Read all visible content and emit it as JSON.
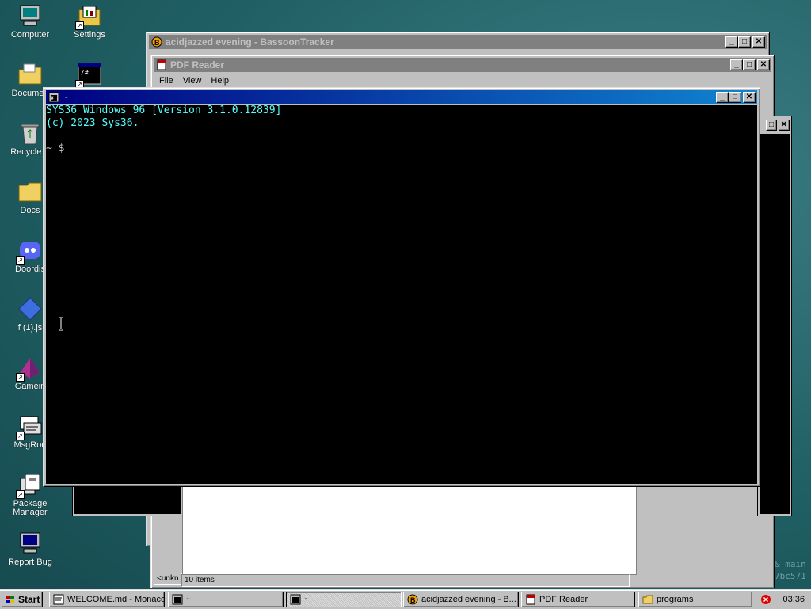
{
  "desktop": {
    "icons": [
      {
        "label": "Computer"
      },
      {
        "label": "Settings"
      },
      {
        "label": "Documen"
      },
      {
        "label": "Recycle B"
      },
      {
        "label": "Docs"
      },
      {
        "label": "Doordis"
      },
      {
        "label": "f (1).js"
      },
      {
        "label": "Gamein"
      },
      {
        "label": "MsgRoo"
      },
      {
        "label": "Package Manager"
      },
      {
        "label": "Report Bug"
      }
    ],
    "background_text": [
      "& main",
      "7bc571"
    ]
  },
  "windows": {
    "bassoon": {
      "title": "acidjazzed evening - BassoonTracker"
    },
    "pdf": {
      "title": "PDF Reader",
      "menu": [
        "File",
        "View",
        "Help"
      ]
    },
    "explorer": {
      "status_left": "<unkn",
      "status_items": "10 items"
    },
    "terminal": {
      "title": "~",
      "lines": [
        "SYS36 Windows 96 [Version 3.1.0.12839]",
        "(c) 2023 Sys36."
      ],
      "prompt": "~ $"
    }
  },
  "taskbar": {
    "start_label": "Start",
    "tasks": [
      {
        "label": "WELCOME.md - Monaco"
      },
      {
        "label": "~"
      },
      {
        "label": "~"
      },
      {
        "label": "acidjazzed evening - B..."
      },
      {
        "label": "PDF Reader"
      },
      {
        "label": "programs"
      }
    ],
    "clock": "03:36"
  },
  "colors": {
    "desktop": "#1f5f63",
    "title_active": "#000080",
    "terminal_text": "#55ffff"
  }
}
